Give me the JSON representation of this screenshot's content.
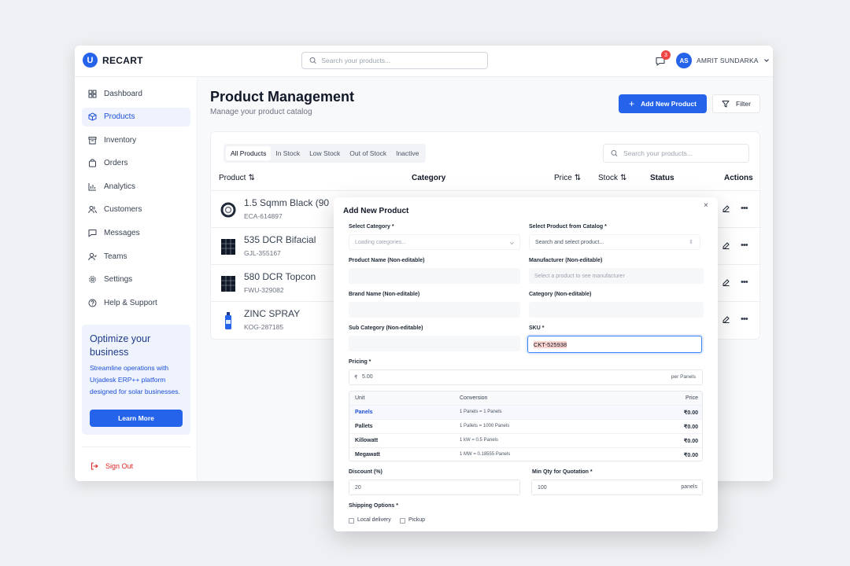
{
  "brand": {
    "logo_letter": "U",
    "name": "RECART"
  },
  "header": {
    "search_placeholder": "Search your products...",
    "notification_count": "3",
    "user_initials": "AS",
    "user_name": "AMRIT SUNDARKA"
  },
  "sidebar": {
    "items": [
      {
        "label": "Dashboard",
        "icon": "grid-icon"
      },
      {
        "label": "Products",
        "icon": "box-icon",
        "active": true
      },
      {
        "label": "Inventory",
        "icon": "archive-icon"
      },
      {
        "label": "Orders",
        "icon": "bag-icon"
      },
      {
        "label": "Analytics",
        "icon": "bar-chart-icon"
      },
      {
        "label": "Customers",
        "icon": "users-icon"
      },
      {
        "label": "Messages",
        "icon": "message-icon"
      },
      {
        "label": "Teams",
        "icon": "team-icon"
      },
      {
        "label": "Settings",
        "icon": "gear-icon"
      },
      {
        "label": "Help & Support",
        "icon": "help-icon"
      }
    ],
    "promo": {
      "title": "Optimize your business",
      "text": "Streamline operations with Urjadesk ERP++ platform designed for solar businesses.",
      "button": "Learn More"
    },
    "sign_out": "Sign Out"
  },
  "main": {
    "title": "Product Management",
    "subtitle": "Manage your product catalog",
    "add_button": "Add New Product",
    "filter_button": "Filter",
    "tabs": [
      "All Products",
      "In Stock",
      "Low Stock",
      "Out of Stock",
      "Inactive"
    ],
    "table_search_placeholder": "Search your products...",
    "columns": {
      "product": "Product",
      "category": "Category",
      "price": "Price",
      "stock": "Stock",
      "status": "Status",
      "actions": "Actions"
    },
    "rows": [
      {
        "name": "1.5 Sqmm Black (90",
        "sku": "ECA-614897",
        "thumb": "cable-coil"
      },
      {
        "name": "535 DCR Bifacial",
        "sku": "GJL-355167",
        "thumb": "solar-panel"
      },
      {
        "name": "580 DCR Topcon",
        "sku": "FWU-329082",
        "thumb": "solar-panel"
      },
      {
        "name": "ZINC SPRAY",
        "sku": "KOG-287185",
        "thumb": "spray-can"
      }
    ]
  },
  "modal": {
    "title": "Add New Product",
    "close": "×",
    "select_category_label": "Select Category *",
    "select_category_placeholder": "Loading categories...",
    "select_product_label": "Select Product from Catalog *",
    "select_product_placeholder": "Search and select product...",
    "product_name_label": "Product Name (Non-editable)",
    "manufacturer_label": "Manufacturer (Non-editable)",
    "manufacturer_placeholder": "Select a product to see manufacturer",
    "brand_name_label": "Brand Name (Non-editable)",
    "category_label": "Category (Non-editable)",
    "sub_category_label": "Sub Category (Non-editable)",
    "sku_label": "SKU *",
    "sku_value": "CKT-525938",
    "pricing_label": "Pricing *",
    "currency": "₹",
    "price_value": "5.00",
    "price_unit": "per Panels",
    "unit_table": {
      "headers": [
        "Unit",
        "Conversion",
        "Price"
      ],
      "rows": [
        {
          "unit": "Panels",
          "conversion": "1 Panels = 1 Panels",
          "price": "₹0.00"
        },
        {
          "unit": "Pallets",
          "conversion": "1 Pallets = 1000 Panels",
          "price": "₹0.00"
        },
        {
          "unit": "Killowatt",
          "conversion": "1 kW = 0.5 Panels",
          "price": "₹0.00"
        },
        {
          "unit": "Megawatt",
          "conversion": "1 MW = 0.18555 Panels",
          "price": "₹0.00"
        }
      ]
    },
    "discount_label": "Discount (%)",
    "discount_value": "20",
    "min_qty_label": "Min Qty for Quotation *",
    "min_qty_value": "100",
    "min_qty_unit": "panels",
    "shipping_label": "Shipping Options *",
    "shipping_options": [
      "Local delivery",
      "Pickup"
    ]
  },
  "colors": {
    "accent": "#2563eb",
    "danger": "#dc2626",
    "badge": "#ef4444"
  }
}
